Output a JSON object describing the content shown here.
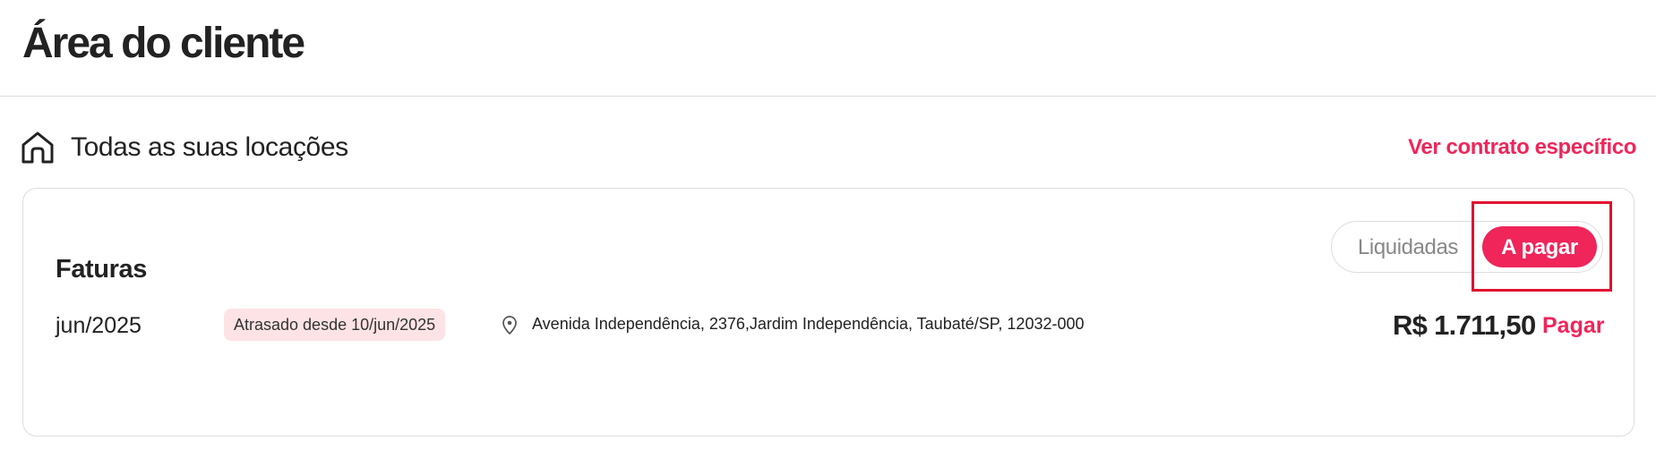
{
  "page": {
    "title": "Área do cliente"
  },
  "section": {
    "icon": "home-icon",
    "title": "Todas as suas locações",
    "specific_contract_link": "Ver contrato específico"
  },
  "invoices": {
    "title": "Faturas",
    "filter": {
      "paid_label": "Liquidadas",
      "due_label": "A pagar",
      "selected": "A pagar"
    },
    "rows": [
      {
        "period": "jun/2025",
        "status": "Atrasado desde 10/jun/2025",
        "location_icon": "map-pin-icon",
        "address": "Avenida Independência, 2376,Jardim Independência, Taubaté/SP, 12032-000",
        "amount": "R$ 1.711,50",
        "action_label": "Pagar"
      }
    ]
  },
  "colors": {
    "accent": "#f0255a",
    "text": "#222222",
    "muted_text": "#888888",
    "border": "#dddddd",
    "status_badge_background": "#fde3e5",
    "highlight": "#e0112f"
  }
}
